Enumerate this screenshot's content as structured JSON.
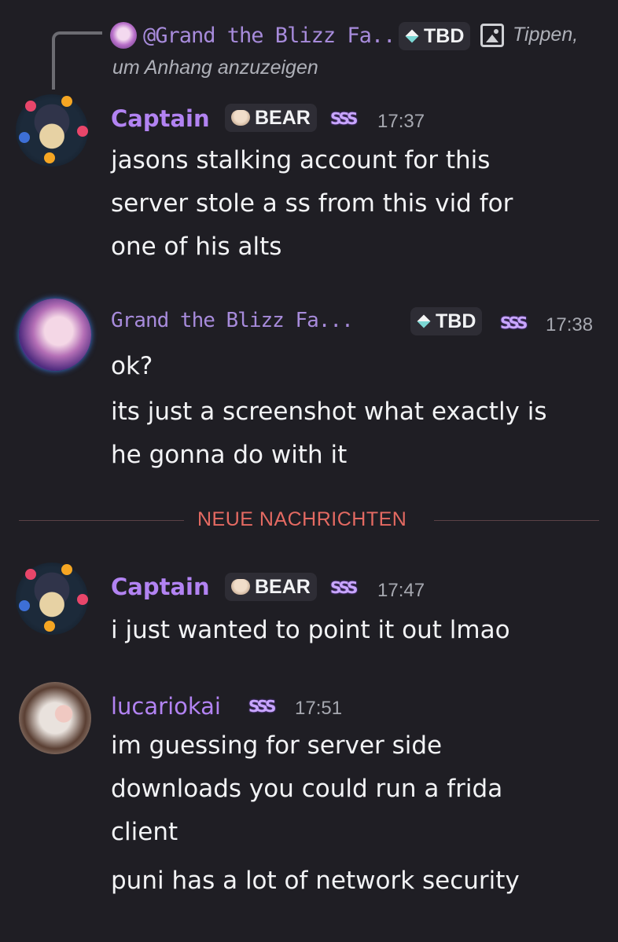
{
  "reply": {
    "author": "@Grand the Blizz Fa...",
    "tag": "TBD",
    "hint_line1": "Tippen,",
    "hint_line2": "um Anhang anzuzeigen"
  },
  "messages": [
    {
      "author": "Captain",
      "tag": "BEAR",
      "badge": "SSS",
      "time": "17:37",
      "lines": [
        "jasons stalking account for this",
        "server stole a ss from this vid for",
        "one of his alts"
      ]
    },
    {
      "author": "Grand the Blizz Fa...",
      "tag": "TBD",
      "badge": "SSS",
      "time": "17:38",
      "lines": [
        "ok?",
        "its just a screenshot what exactly is",
        "he gonna do with it"
      ]
    },
    {
      "author": "Captain",
      "tag": "BEAR",
      "badge": "SSS",
      "time": "17:47",
      "lines": [
        "i just wanted to point it out lmao"
      ]
    },
    {
      "author": "lucariokai",
      "badge": "SSS",
      "time": "17:51",
      "lines": [
        "im guessing for server side",
        "downloads you could run a frida",
        "client",
        "puni has a lot of network security"
      ]
    }
  ],
  "divider": "NEUE NACHRICHTEN",
  "icons": {
    "tag_tbd": "diamond-icon",
    "tag_bear": "heart-icon",
    "attachment": "image-icon"
  },
  "colors": {
    "background": "#1f1e24",
    "username": "#b283f2",
    "new_messages": "#e46a62"
  }
}
